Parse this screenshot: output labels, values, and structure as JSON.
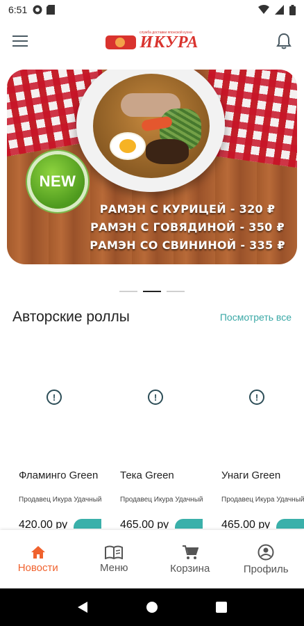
{
  "status_bar": {
    "time": "6:51",
    "left_icons": [
      "pocket-casts-icon",
      "sd-card-icon"
    ],
    "right_icons": [
      "wifi-icon",
      "cellular-icon",
      "battery-icon"
    ]
  },
  "app_bar": {
    "menu_icon": "hamburger-menu-icon",
    "logo_text": "ИКУРА",
    "logo_subtitle": "служба доставки японской кухни",
    "notification_icon": "bell-icon"
  },
  "banner": {
    "badge": "NEW",
    "lines": [
      "РАМЭН С КУРИЦЕЙ - 320 ₽",
      "РАМЭН С ГОВЯДИНОЙ - 350 ₽",
      "РАМЭН СО СВИНИНОЙ - 335 ₽"
    ],
    "carousel_pages": 3,
    "carousel_active": 2
  },
  "section": {
    "title": "Авторские роллы",
    "see_all": "Посмотреть все"
  },
  "products": [
    {
      "name": "Фламинго Green",
      "seller": "Продавец Икура Удачный",
      "price": "420.00 ру",
      "image_state": "image-not-loaded-icon"
    },
    {
      "name": "Тека Green",
      "seller": "Продавец Икура Удачный",
      "price": "465.00 ру",
      "image_state": "image-not-loaded-icon"
    },
    {
      "name": "Унаги Green",
      "seller": "Продавец Икура Удачный",
      "price": "465.00 ру",
      "image_state": "image-not-loaded-icon"
    }
  ],
  "bottom_nav": {
    "items": [
      {
        "label": "Новости",
        "icon": "home-icon",
        "active": true
      },
      {
        "label": "Меню",
        "icon": "book-icon",
        "active": false
      },
      {
        "label": "Корзина",
        "icon": "cart-icon",
        "active": false
      },
      {
        "label": "Профиль",
        "icon": "account-icon",
        "active": false
      }
    ]
  },
  "colors": {
    "accent": "#f0622e",
    "teal": "#3aa8a6",
    "brand_red": "#d9332e"
  }
}
